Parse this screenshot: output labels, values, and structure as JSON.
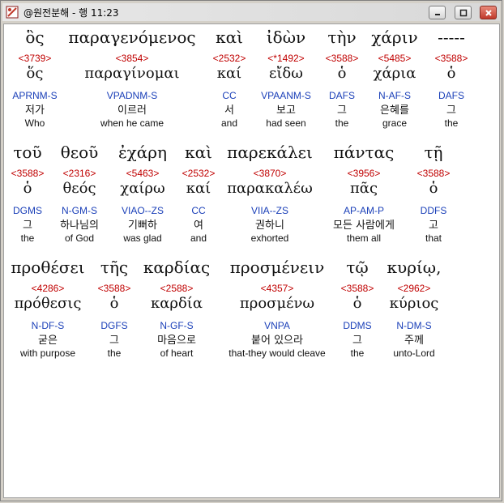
{
  "window": {
    "title": "@원전분해 - 행 11:23",
    "icons": {
      "app": "bible-app-icon",
      "minimize": "minimize-icon",
      "maximize": "maximize-icon",
      "close": "close-icon"
    }
  },
  "rows": [
    {
      "words": [
        {
          "greek": "ὃς",
          "strong": "<3739>",
          "lexeme": "ὅς",
          "parse": "APRNM-S",
          "korean": "저가",
          "english": "Who"
        },
        {
          "greek": "παραγενόμενος",
          "strong": "<3854>",
          "lexeme": "παραγίνομαι",
          "parse": "VPADNM-S",
          "korean": "이르러",
          "english": "when he came"
        },
        {
          "greek": "καὶ",
          "strong": "<2532>",
          "lexeme": "καί",
          "parse": "CC",
          "korean": "서",
          "english": "and"
        },
        {
          "greek": "ἰδὼν",
          "strong": "<*1492>",
          "lexeme": "εἴδω",
          "parse": "VPAANM-S",
          "korean": "보고",
          "english": "had seen"
        },
        {
          "greek": "τὴν",
          "strong": "<3588>",
          "lexeme": "ὁ",
          "parse": "DAFS",
          "korean": "그",
          "english": "the"
        },
        {
          "greek": "χάριν",
          "strong": "<5485>",
          "lexeme": "χάρια",
          "parse": "N-AF-S",
          "korean": "은혜를",
          "english": "grace"
        },
        {
          "greek": "-----",
          "strong": "<3588>",
          "lexeme": "ὁ",
          "parse": "DAFS",
          "korean": "그",
          "english": "the"
        }
      ]
    },
    {
      "words": [
        {
          "greek": "τοῦ",
          "strong": "<3588>",
          "lexeme": "ὁ",
          "parse": "DGMS",
          "korean": "그",
          "english": "the"
        },
        {
          "greek": "θεοῦ",
          "strong": "<2316>",
          "lexeme": "θεός",
          "parse": "N-GM-S",
          "korean": "하나님의",
          "english": "of God"
        },
        {
          "greek": "ἐχάρη",
          "strong": "<5463>",
          "lexeme": "χαίρω",
          "parse": "VIAO--ZS",
          "korean": "기뻐하",
          "english": "was glad"
        },
        {
          "greek": "καὶ",
          "strong": "<2532>",
          "lexeme": "καί",
          "parse": "CC",
          "korean": "여",
          "english": "and"
        },
        {
          "greek": "παρεκάλει",
          "strong": "<3870>",
          "lexeme": "παρακαλέω",
          "parse": "VIIA--ZS",
          "korean": "권하니",
          "english": "exhorted"
        },
        {
          "greek": "πάντας",
          "strong": "<3956>",
          "lexeme": "πᾶς",
          "parse": "AP-AM-P",
          "korean": "모든 사람에게",
          "english": "them all"
        },
        {
          "greek": "τῇ",
          "strong": "<3588>",
          "lexeme": "ὁ",
          "parse": "DDFS",
          "korean": "고",
          "english": "that"
        }
      ]
    },
    {
      "words": [
        {
          "greek": "προθέσει",
          "strong": "<4286>",
          "lexeme": "πρόθεσις",
          "parse": "N-DF-S",
          "korean": "굳은",
          "english": "with purpose"
        },
        {
          "greek": "τῆς",
          "strong": "<3588>",
          "lexeme": "ὁ",
          "parse": "DGFS",
          "korean": "그",
          "english": "the"
        },
        {
          "greek": "καρδίας",
          "strong": "<2588>",
          "lexeme": "καρδία",
          "parse": "N-GF-S",
          "korean": "마음으로",
          "english": "of heart"
        },
        {
          "greek": "προσμένειν",
          "strong": "<4357>",
          "lexeme": "προσμένω",
          "parse": "VNPA",
          "korean": "붙어 있으라",
          "english": "that-they would cleave"
        },
        {
          "greek": "τῷ",
          "strong": "<3588>",
          "lexeme": "ὁ",
          "parse": "DDMS",
          "korean": "그",
          "english": "the"
        },
        {
          "greek": "κυρίῳ,",
          "strong": "<2962>",
          "lexeme": "κύριος",
          "parse": "N-DM-S",
          "korean": "주께",
          "english": "unto-Lord"
        }
      ]
    }
  ]
}
